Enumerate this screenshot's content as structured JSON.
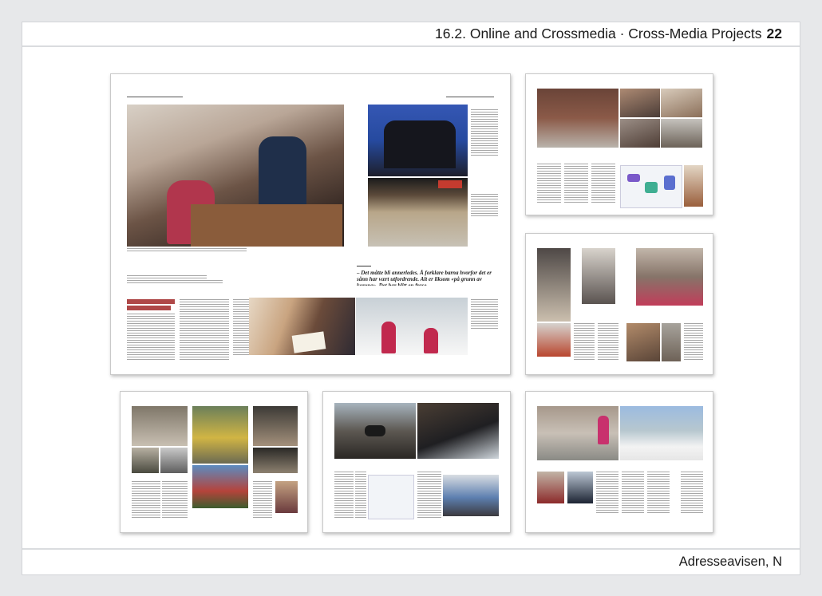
{
  "header": {
    "section": "16.2. Online and Crossmedia · Cross-Media Projects",
    "page_number": "22"
  },
  "footer": {
    "credit": "Adresseavisen, N"
  },
  "main_spread": {
    "pull_quote": "– Det måtte bli annerledes. Å forklare barna hvorfor det er sånn har vært utfordrende. Alt er liksom «på grunn av korona». Det har blitt en frase."
  },
  "colors": {
    "accent_red": "#a12828",
    "page_bg": "#e7e8ea"
  }
}
